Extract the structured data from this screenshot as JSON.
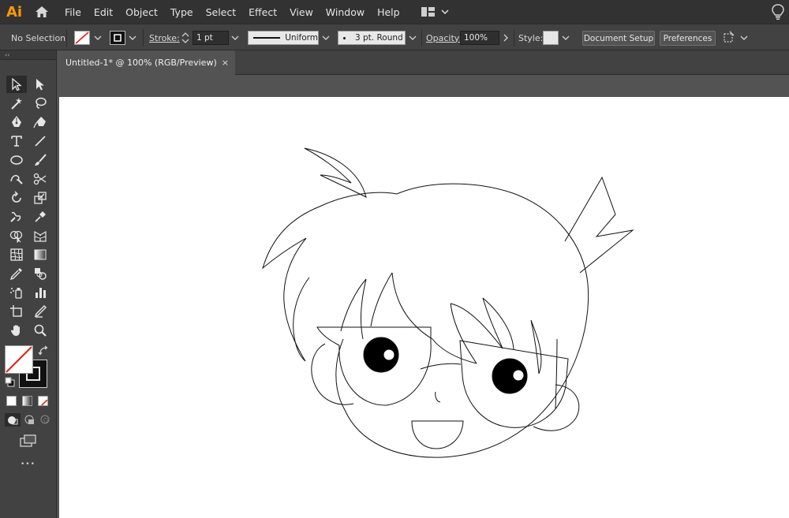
{
  "app": {
    "logo_text": "Ai"
  },
  "menu": [
    "File",
    "Edit",
    "Object",
    "Type",
    "Select",
    "Effect",
    "View",
    "Window",
    "Help"
  ],
  "control": {
    "selection": "No Selection",
    "stroke_label": "Stroke:",
    "stroke_weight": "1 pt",
    "profile_label": "Uniform",
    "brush_label": "3 pt. Round",
    "opacity_label": "Opacity:",
    "opacity_value": "100%",
    "style_label": "Style:",
    "document_setup": "Document Setup",
    "preferences": "Preferences"
  },
  "document": {
    "tab_title": "Untitled-1* @ 100% (RGB/Preview)",
    "close_glyph": "×"
  },
  "toolbar": {
    "collapse_glyph": "‹‹",
    "more_glyph": "•••"
  },
  "colors": {
    "brand": "#ff9a00",
    "stroke_red": "#e0201a",
    "menubar": "#323232",
    "panel": "#424242"
  }
}
